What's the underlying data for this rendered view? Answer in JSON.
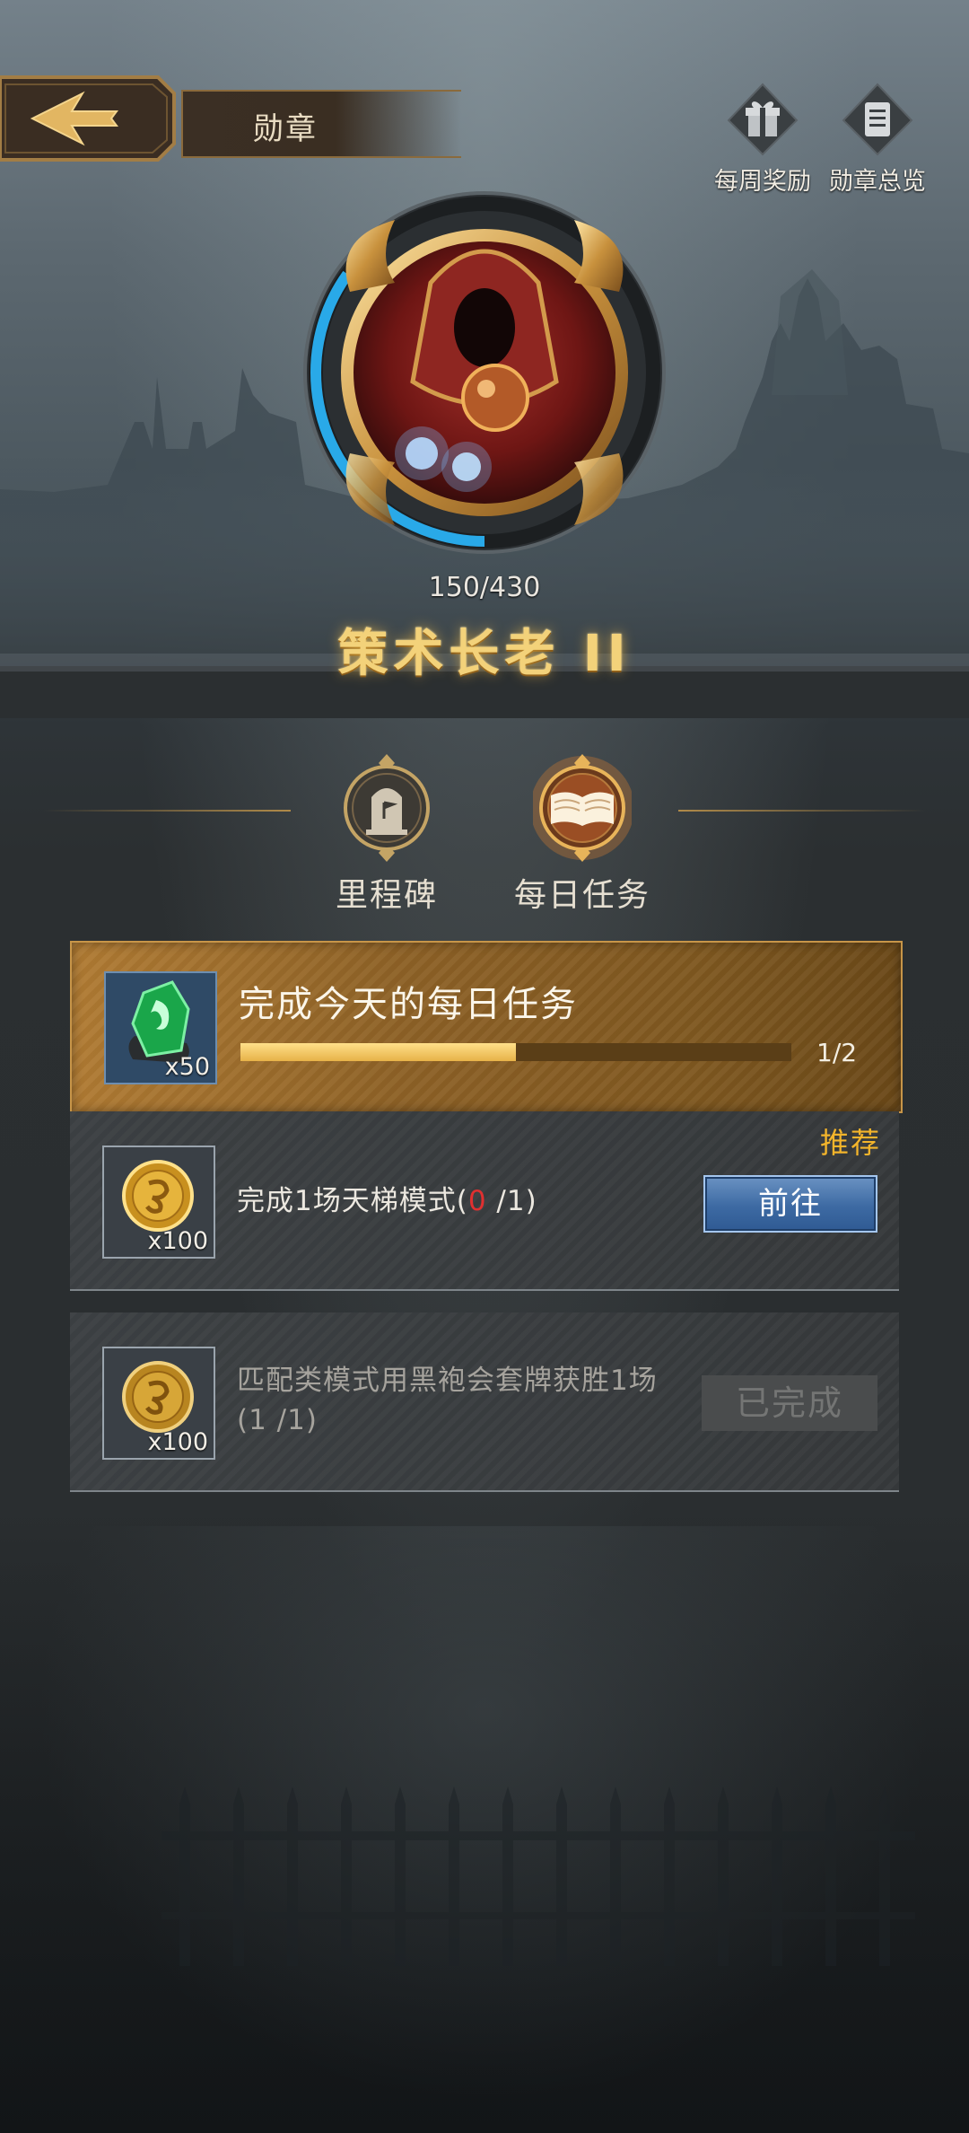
{
  "header": {
    "title": "勋章",
    "actions": [
      {
        "label": "每周奖励",
        "icon": "gift-icon"
      },
      {
        "label": "勋章总览",
        "icon": "list-icon"
      }
    ]
  },
  "badge": {
    "progress_text": "150/430",
    "progress_fraction": 0.349,
    "rank_name": "策术长老 II"
  },
  "tabs": [
    {
      "label": "里程碑",
      "icon": "monument-icon",
      "selected": false
    },
    {
      "label": "每日任务",
      "icon": "book-icon",
      "selected": true
    }
  ],
  "daily_summary": {
    "title": "完成今天的每日任务",
    "reward_qty": "x50",
    "reward_icon": "green-gem-icon",
    "progress_text": "1/2",
    "progress_fraction": 0.5
  },
  "tasks": [
    {
      "desc_prefix": "完成1场天梯模式(",
      "progress_done": "0",
      "progress_total": " /1",
      "desc_suffix": ")",
      "reward_qty": "x100",
      "reward_icon": "gold-coin-icon",
      "tag": "推荐",
      "button": "前往"
    },
    {
      "desc_line1": "匹配类模式用黑袍会套牌获胜1场",
      "desc_line2": "(1 /1)",
      "reward_qty": "x100",
      "reward_icon": "gold-coin-icon",
      "button": "已完成"
    }
  ],
  "colors": {
    "accent_gold": "#f3d27a",
    "progress_blue": "#29a9e8",
    "recommend_orange": "#f4b52b",
    "go_button_blue": "#3d6aa3"
  }
}
